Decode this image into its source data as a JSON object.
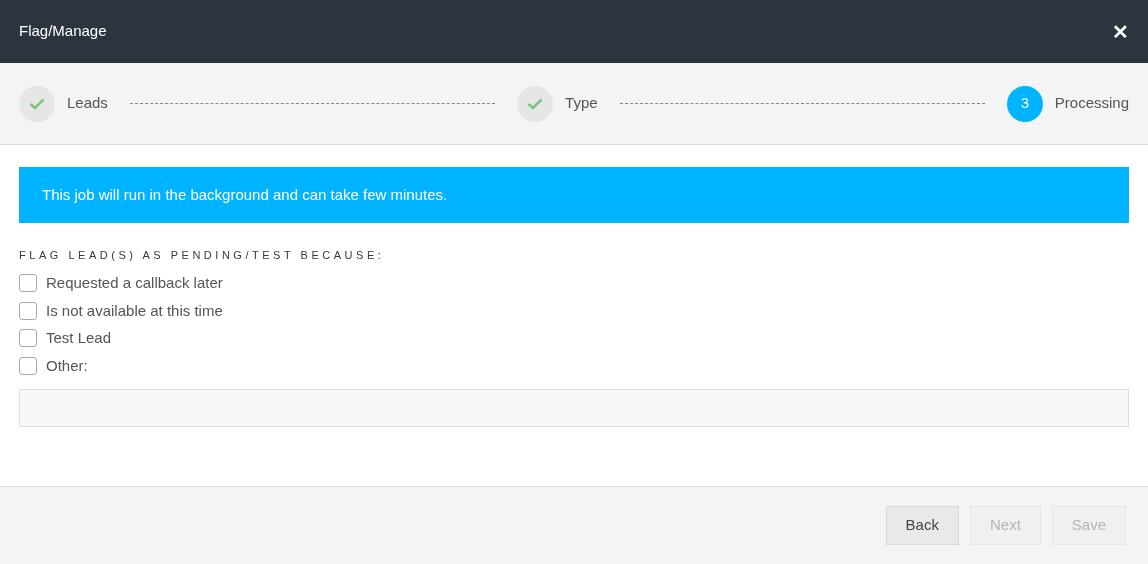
{
  "window": {
    "title": "Flag/Manage",
    "close": "✕"
  },
  "steps": [
    {
      "label": "Leads",
      "completed": true
    },
    {
      "label": "Type",
      "completed": true
    },
    {
      "label": "Processing",
      "completed": false,
      "number": "3"
    }
  ],
  "notice": "This job will run in the background and can take few minutes.",
  "section_label": "FLAG LEAD(S) AS PENDING/TEST BECAUSE:",
  "options": [
    {
      "label": "Requested a callback later",
      "checked": false
    },
    {
      "label": "Is not available at this time",
      "checked": false
    },
    {
      "label": "Test Lead",
      "checked": false
    },
    {
      "label": "Other:",
      "checked": false
    }
  ],
  "buttons": [
    {
      "label": "Back",
      "disabled": false
    },
    {
      "label": "Next",
      "disabled": true
    },
    {
      "label": "Save",
      "disabled": true
    }
  ]
}
